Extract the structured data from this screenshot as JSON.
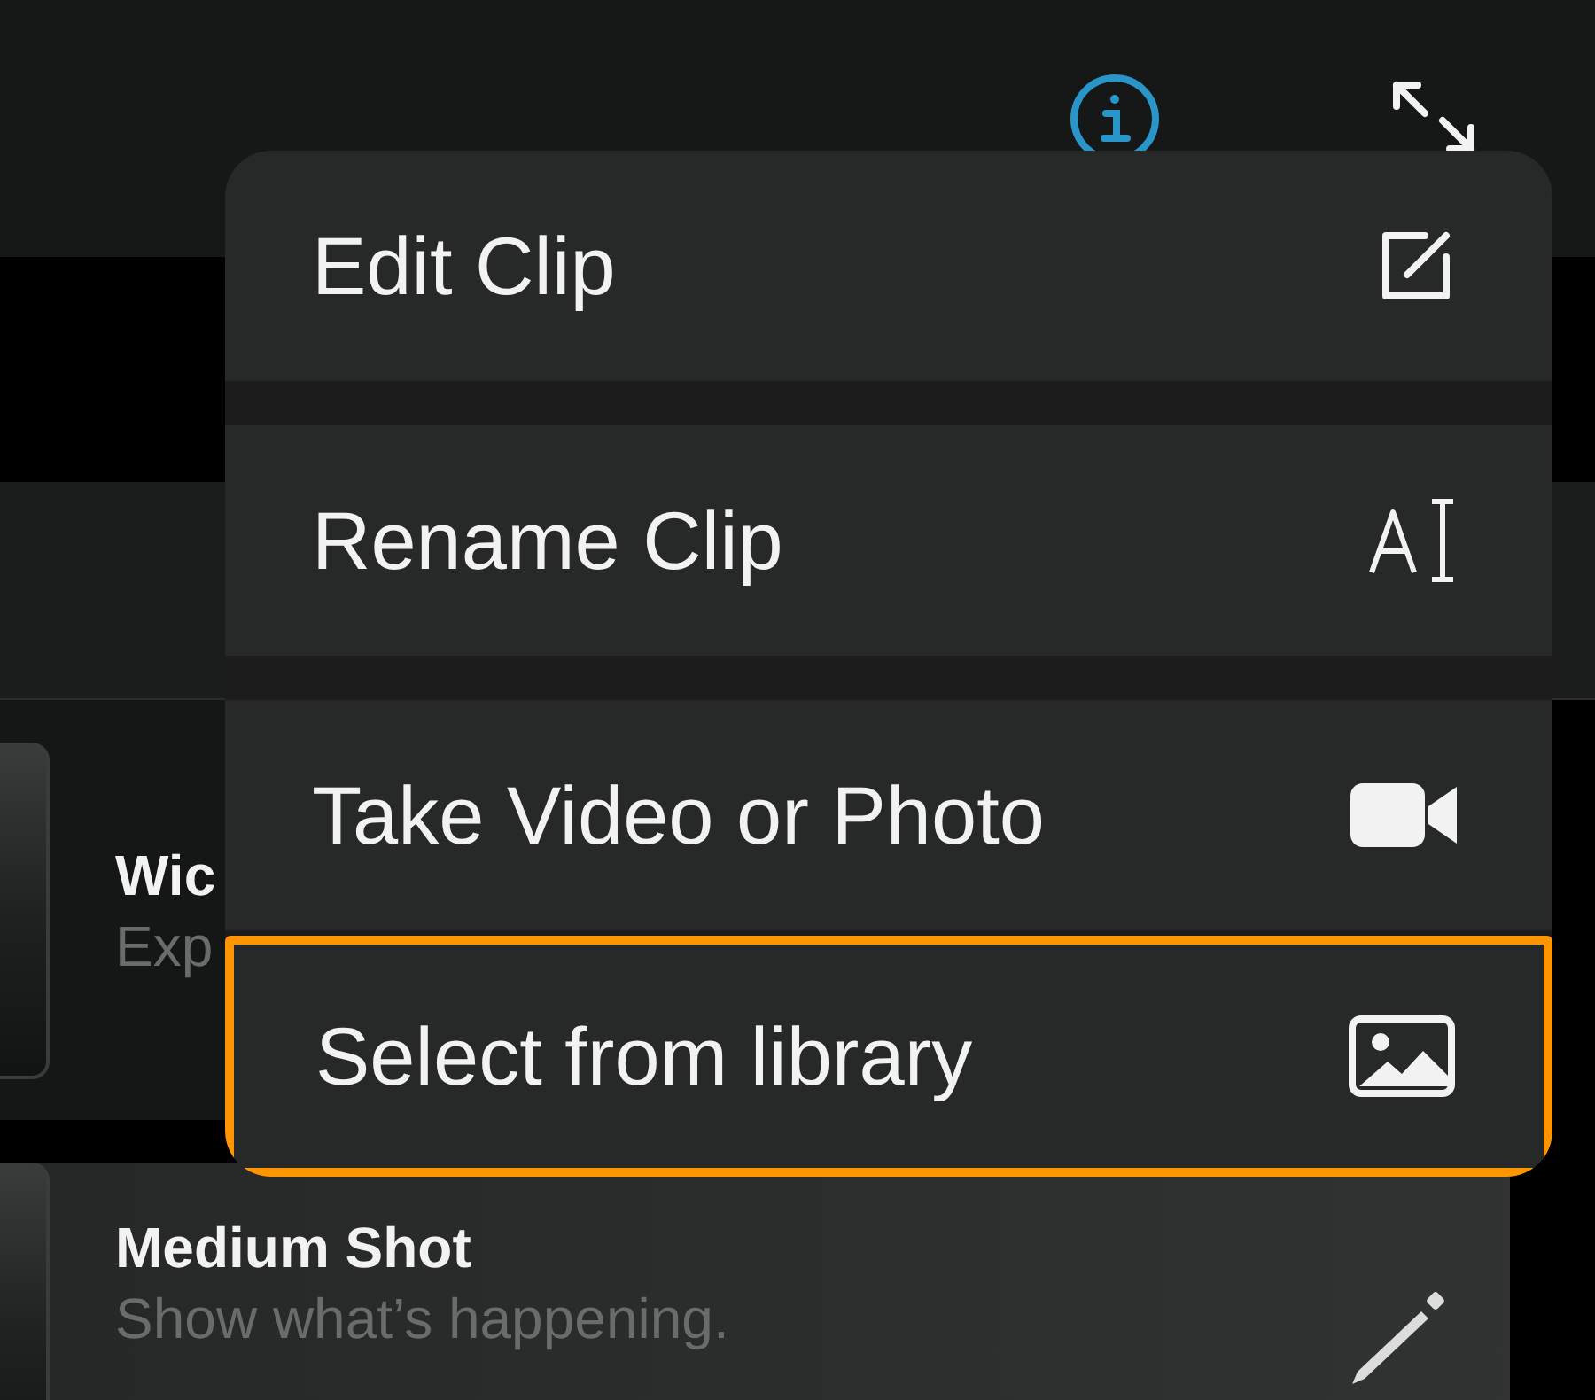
{
  "shots": [
    {
      "title": "Wic",
      "subtitle": "Exp",
      "selected": false,
      "kind": "plain"
    },
    {
      "title": "Medium Shot",
      "subtitle": "Show what’s happening.",
      "selected": true,
      "kind": "editable"
    }
  ],
  "menu": [
    {
      "label": "Edit Clip",
      "kind": "edit",
      "highlighted": false
    },
    {
      "label": "Rename Clip",
      "kind": "rename",
      "highlighted": false
    },
    {
      "label": "Take Video or Photo",
      "kind": "camera",
      "highlighted": false
    },
    {
      "label": "Select from library",
      "kind": "photo",
      "highlighted": true
    }
  ]
}
